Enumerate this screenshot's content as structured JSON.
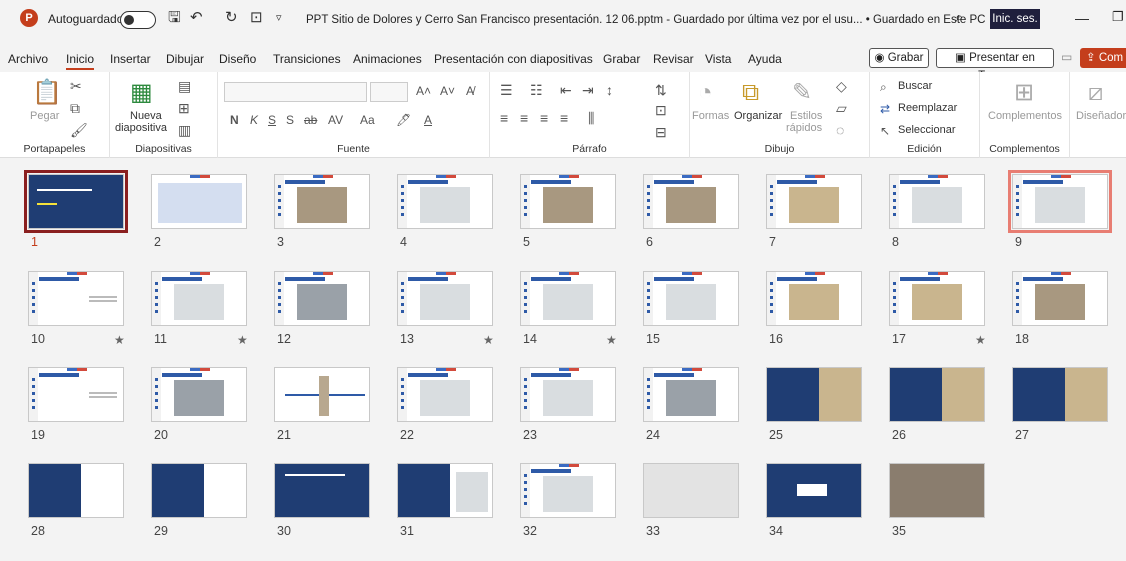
{
  "titlebar": {
    "autosave": "Autoguardado",
    "doc_title": "PPT Sitio de Dolores y Cerro San Francisco presentación. 12 06.pptm - Guardado por última vez por el usu... • Guardado en Este PC ∨",
    "signin": "Inic. ses."
  },
  "menu": [
    "Archivo",
    "Inicio",
    "Insertar",
    "Dibujar",
    "Diseño",
    "Transiciones",
    "Animaciones",
    "Presentación con diapositivas",
    "Grabar",
    "Revisar",
    "Vista",
    "Ayuda"
  ],
  "menu_buttons": {
    "grabar": "Grabar",
    "teams": "Presentar en Teams",
    "share": "Com"
  },
  "ribbon": {
    "portapapeles": {
      "label": "Portapapeles",
      "pegar": "Pegar"
    },
    "diapositivas": {
      "label": "Diapositivas",
      "nueva": "Nueva",
      "diapositiva": "diapositiva"
    },
    "fuente": {
      "label": "Fuente"
    },
    "parrafo": {
      "label": "Párrafo"
    },
    "dibujo": {
      "label": "Dibujo",
      "formas": "Formas",
      "organizar": "Organizar",
      "estilos": "Estilos",
      "rapidos": "rápidos"
    },
    "edicion": {
      "label": "Edición",
      "buscar": "Buscar",
      "reemplazar": "Reemplazar",
      "seleccionar": "Seleccionar"
    },
    "complementos": {
      "label": "Complementos",
      "btn": "Complementos",
      "disenador": "Diseñador"
    }
  },
  "slides": [
    {
      "n": "1",
      "star": false
    },
    {
      "n": "2",
      "star": false
    },
    {
      "n": "3",
      "star": false
    },
    {
      "n": "4",
      "star": false
    },
    {
      "n": "5",
      "star": false
    },
    {
      "n": "6",
      "star": false
    },
    {
      "n": "7",
      "star": false
    },
    {
      "n": "8",
      "star": false
    },
    {
      "n": "9",
      "star": false
    },
    {
      "n": "10",
      "star": true
    },
    {
      "n": "11",
      "star": true
    },
    {
      "n": "12",
      "star": false
    },
    {
      "n": "13",
      "star": true
    },
    {
      "n": "14",
      "star": true
    },
    {
      "n": "15",
      "star": false
    },
    {
      "n": "16",
      "star": false
    },
    {
      "n": "17",
      "star": true
    },
    {
      "n": "18",
      "star": false
    },
    {
      "n": "19",
      "star": false
    },
    {
      "n": "20",
      "star": false
    },
    {
      "n": "21",
      "star": false
    },
    {
      "n": "22",
      "star": false
    },
    {
      "n": "23",
      "star": false
    },
    {
      "n": "24",
      "star": false
    },
    {
      "n": "25",
      "star": false
    },
    {
      "n": "26",
      "star": false
    },
    {
      "n": "27",
      "star": false
    },
    {
      "n": "28",
      "star": false
    },
    {
      "n": "29",
      "star": false
    },
    {
      "n": "30",
      "star": false
    },
    {
      "n": "31",
      "star": false
    },
    {
      "n": "32",
      "star": false
    },
    {
      "n": "33",
      "star": false
    },
    {
      "n": "34",
      "star": false
    },
    {
      "n": "35",
      "star": false
    }
  ],
  "selected_slide": "1",
  "star_glyph": "★"
}
